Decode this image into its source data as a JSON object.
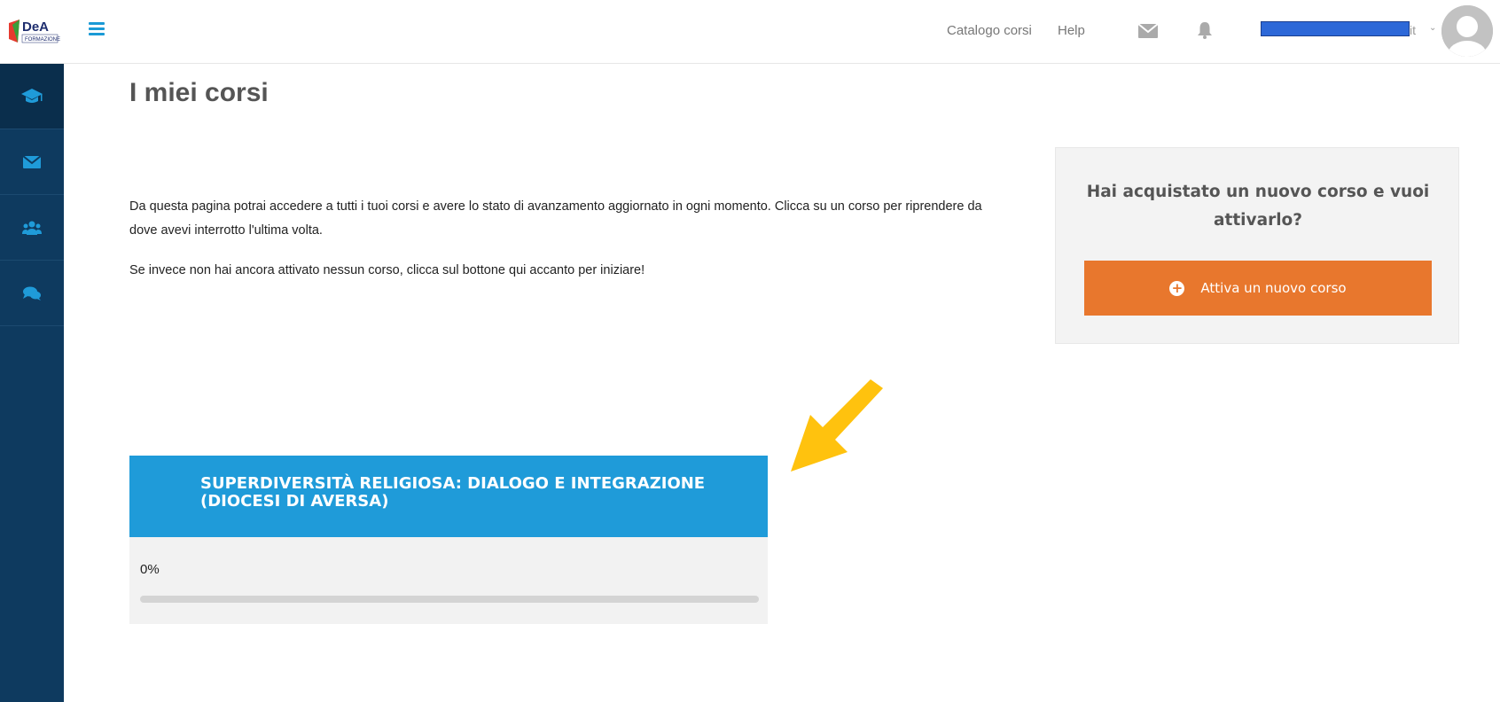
{
  "header": {
    "logo_text": "DeA",
    "logo_subtext": "FORMAZIONE",
    "nav_links": [
      "Catalogo corsi",
      "Help"
    ],
    "user_suffix": "it"
  },
  "sidebar": {
    "items": [
      {
        "icon": "graduation-cap-icon"
      },
      {
        "icon": "envelope-icon"
      },
      {
        "icon": "users-icon"
      },
      {
        "icon": "comments-icon"
      }
    ]
  },
  "main": {
    "title": "I miei corsi",
    "intro_p1": "Da questa pagina potrai accedere a tutti i tuoi corsi e avere lo stato di avanzamento aggiornato in ogni momento. Clicca su un corso per riprendere da dove avevi interrotto l'ultima volta.",
    "intro_p2": "Se invece non hai ancora attivato nessun corso, clicca sul bottone qui accanto per iniziare!"
  },
  "activate_box": {
    "title": "Hai acquistato un nuovo corso e vuoi attivarlo?",
    "button_label": "Attiva un nuovo corso"
  },
  "course": {
    "title": "SUPERDIVERSITÀ RELIGIOSA: DIALOGO E INTEGRAZIONE (DIOCESI DI AVERSA)",
    "progress_label": "0%",
    "progress": 0
  },
  "colors": {
    "accent": "#1f9bd9",
    "sidebar": "#0e3a5f",
    "button": "#e8772d",
    "annotation_arrow": "#ffc20e"
  }
}
